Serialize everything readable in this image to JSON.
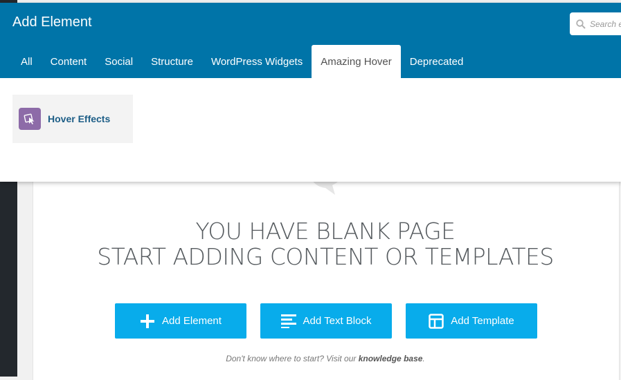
{
  "panel": {
    "title": "Add Element",
    "search_placeholder": "Search element"
  },
  "tabs": [
    {
      "label": "All"
    },
    {
      "label": "Content"
    },
    {
      "label": "Social"
    },
    {
      "label": "Structure"
    },
    {
      "label": "WordPress Widgets"
    },
    {
      "label": "Amazing Hover",
      "active": true
    },
    {
      "label": "Deprecated"
    }
  ],
  "elements": [
    {
      "label": "Hover Effects",
      "icon": "hover-effects-icon",
      "icon_color": "#8d6ba8"
    }
  ],
  "blank_page": {
    "line1": "YOU HAVE BLANK PAGE",
    "line2": "START ADDING CONTENT OR TEMPLATES",
    "buttons": [
      {
        "label": "Add Element",
        "icon": "plus-icon"
      },
      {
        "label": "Add Text Block",
        "icon": "text-lines-icon"
      },
      {
        "label": "Add Template",
        "icon": "template-layout-icon"
      }
    ],
    "help_prefix": "Don't know where to start? Visit our ",
    "help_link": "knowledge base",
    "help_suffix": "."
  },
  "colors": {
    "header_blue": "#0074a8",
    "button_blue": "#08aceb",
    "element_icon_purple": "#8d6ba8",
    "element_label": "#1c5d86"
  }
}
